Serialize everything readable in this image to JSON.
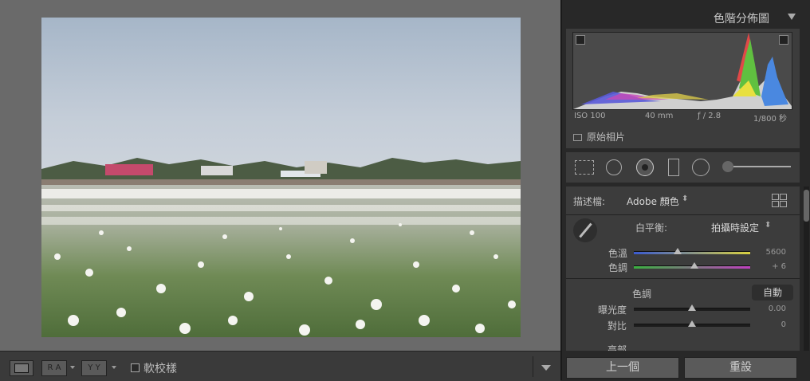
{
  "histogram": {
    "title": "色階分佈圖",
    "iso": "ISO 100",
    "focal": "40 mm",
    "aperture": "ƒ / 2.8",
    "shutter": "1/800 秒",
    "original_photo_label": "原始相片"
  },
  "profile": {
    "label": "描述檔:",
    "value": "Adobe 顏色",
    "caret": "⬍"
  },
  "white_balance": {
    "label": "白平衡:",
    "value": "拍攝時設定",
    "temp_label": "色溫",
    "temp_value": "5600",
    "temp_position": 0.5,
    "tint_label": "色調",
    "tint_value": "+ 6",
    "tint_position": 0.52
  },
  "tone": {
    "label": "色調",
    "auto_label": "自動",
    "exposure_label": "曝光度",
    "exposure_value": "0.00",
    "exposure_position": 0.5,
    "contrast_label": "對比",
    "contrast_value": "0",
    "contrast_position": 0.5,
    "highlights_label": "亮部"
  },
  "buttons": {
    "previous": "上一個",
    "reset": "重設"
  },
  "toolbar": {
    "proof_label": "軟校樣",
    "ra_label": "R A",
    "yy_label": "Y Y"
  },
  "colors": {
    "panel": "#3c3c3c",
    "accent": "#c8c8c8"
  }
}
